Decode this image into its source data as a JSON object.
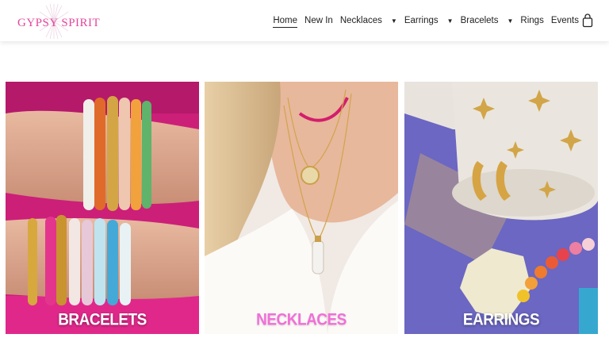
{
  "brand": {
    "name": "GYPSY SPIRIT",
    "color": "#e4479b"
  },
  "nav": {
    "items": [
      {
        "label": "Home",
        "active": true,
        "dropdown": false
      },
      {
        "label": "New In",
        "active": false,
        "dropdown": false
      },
      {
        "label": "Necklaces",
        "active": false,
        "dropdown": true
      },
      {
        "label": "Earrings",
        "active": false,
        "dropdown": true
      },
      {
        "label": "Bracelets",
        "active": false,
        "dropdown": true
      },
      {
        "label": "Rings",
        "active": false,
        "dropdown": false
      },
      {
        "label": "Events",
        "active": false,
        "dropdown": false
      }
    ],
    "caret": "▼",
    "cart_icon": "shopping-bag-icon"
  },
  "tiles": [
    {
      "label": "BRACELETS",
      "label_color": "#ffffff"
    },
    {
      "label": "NECKLACES",
      "label_color": "#f16fd8"
    },
    {
      "label": "EARRINGS",
      "label_color": "#ffffff"
    }
  ]
}
